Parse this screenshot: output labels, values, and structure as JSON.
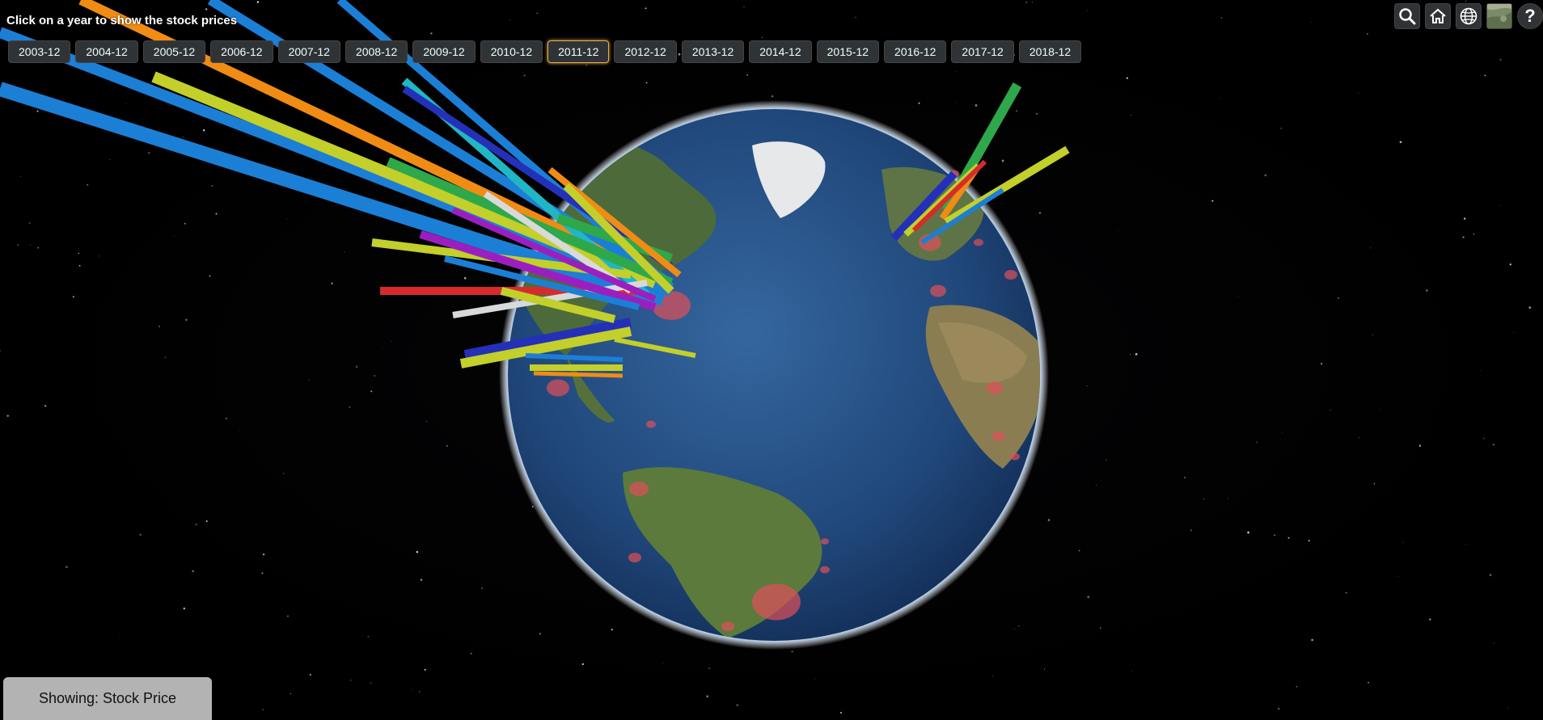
{
  "instruction": "Click on a year to show the stock prices",
  "years": [
    "2003-12",
    "2004-12",
    "2005-12",
    "2006-12",
    "2007-12",
    "2008-12",
    "2009-12",
    "2010-12",
    "2011-12",
    "2012-12",
    "2013-12",
    "2014-12",
    "2015-12",
    "2016-12",
    "2017-12",
    "2018-12"
  ],
  "active_year": "2011-12",
  "toolbar": {
    "search_icon": "search-icon",
    "home_icon": "home-icon",
    "globe_icon": "globe-icon",
    "imagery_icon": "imagery-thumbnail",
    "help_label": "?"
  },
  "status": "Showing: Stock Price",
  "colors": {
    "active_border": "#e8b04a",
    "button_bg": "#303336",
    "status_bg": "#b3b3b3",
    "ocean": "#2d5e9c",
    "bar_palette": [
      "#1c7fd6",
      "#f08c14",
      "#c3cf2a",
      "#2ea84a",
      "#d62b2b",
      "#9b1fc0",
      "#2530b8",
      "#20b6c4",
      "#d9d9d9"
    ]
  }
}
